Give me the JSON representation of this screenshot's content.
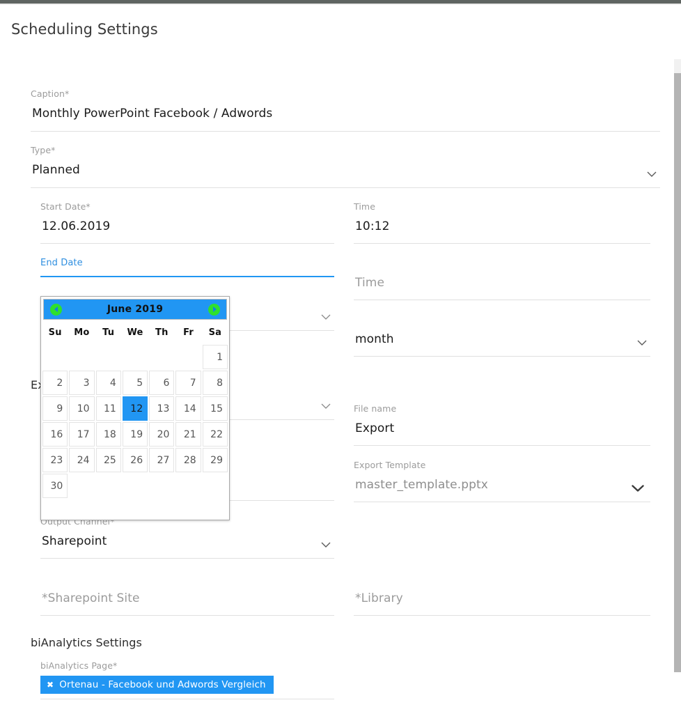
{
  "page": {
    "title": "Scheduling Settings"
  },
  "fields": {
    "caption": {
      "label": "Caption*",
      "value": "Monthly PowerPoint Facebook / Adwords"
    },
    "type": {
      "label": "Type*",
      "value": "Planned",
      "icon": "chevron-down-icon"
    },
    "start_date": {
      "label": "Start Date*",
      "value": "12.06.2019"
    },
    "start_time": {
      "label": "Time",
      "value": "10:12"
    },
    "end_date": {
      "label": "End Date",
      "value": ""
    },
    "end_time": {
      "label": "Time",
      "placeholder": "Time",
      "value": ""
    },
    "interval": {
      "label": "",
      "value": "month",
      "icon": "chevron-down-icon"
    },
    "hidden_select_1": {
      "label": "",
      "value": "",
      "icon": "chevron-down-icon"
    },
    "hidden_select_2": {
      "label": "",
      "value": "",
      "icon": "chevron-down-icon"
    },
    "file_name": {
      "label": "File name",
      "value": "Export"
    },
    "export_template": {
      "label": "Export Template",
      "value": "master_template.pptx",
      "icon": "chevron-down-icon"
    },
    "output_channel": {
      "label": "Output Channel*",
      "value": "Sharepoint",
      "icon": "chevron-down-icon"
    },
    "sharepoint_site": {
      "label": "",
      "placeholder": "*Sharepoint Site",
      "value": ""
    },
    "library": {
      "label": "",
      "placeholder": "*Library",
      "value": ""
    },
    "bianalytics_page": {
      "label": "biAnalytics Page*",
      "chip": "Ortenau - Facebook und Adwords Vergleich",
      "chip_remove": "✖"
    }
  },
  "sections": {
    "export": "Ex",
    "bianalytics": "biAnalytics Settings"
  },
  "datepicker": {
    "title": "June 2019",
    "prev_icon": "prev-month-icon",
    "next_icon": "next-month-icon",
    "weekdays": [
      "Su",
      "Mo",
      "Tu",
      "We",
      "Th",
      "Fr",
      "Sa"
    ],
    "weeks": [
      [
        "",
        "",
        "",
        "",
        "",
        "",
        "1"
      ],
      [
        "2",
        "3",
        "4",
        "5",
        "6",
        "7",
        "8"
      ],
      [
        "9",
        "10",
        "11",
        "12",
        "13",
        "14",
        "15"
      ],
      [
        "16",
        "17",
        "18",
        "19",
        "20",
        "21",
        "22"
      ],
      [
        "23",
        "24",
        "25",
        "26",
        "27",
        "28",
        "29"
      ],
      [
        "30",
        "",
        "",
        "",
        "",
        "",
        ""
      ]
    ],
    "selected": "12"
  },
  "colors": {
    "accent": "#2196f3",
    "nav_green": "#2ee02e",
    "topbar": "#5f6562",
    "label_gray": "#9b9b9b",
    "underline": "#e0e0e0"
  }
}
